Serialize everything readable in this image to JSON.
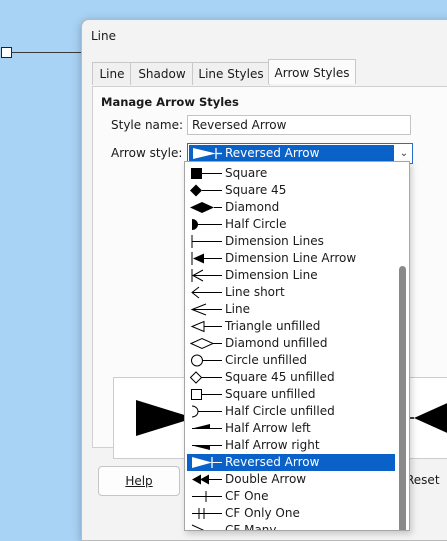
{
  "dialog": {
    "title": "Line",
    "tabs": [
      {
        "label": "Line",
        "active": false
      },
      {
        "label": "Shadow",
        "active": false
      },
      {
        "label": "Line Styles",
        "active": false
      },
      {
        "label": "Arrow Styles",
        "active": true
      }
    ],
    "section_title": "Manage Arrow Styles",
    "style_name_label": "Style name:",
    "style_name_value": "Reversed Arrow",
    "arrow_style_label": "Arrow style:",
    "arrow_style_value": "Reversed Arrow",
    "help_label": "Help",
    "reset_label": "Reset"
  },
  "dropdown": {
    "items": [
      {
        "label": "Square",
        "icon": "square-arrow-icon"
      },
      {
        "label": "Square 45",
        "icon": "square-45-arrow-icon"
      },
      {
        "label": "Diamond",
        "icon": "diamond-arrow-icon"
      },
      {
        "label": "Half Circle",
        "icon": "half-circle-arrow-icon"
      },
      {
        "label": "Dimension Lines",
        "icon": "dimension-lines-arrow-icon"
      },
      {
        "label": "Dimension Line Arrow",
        "icon": "dimension-line-arrow-icon"
      },
      {
        "label": "Dimension Line",
        "icon": "dimension-line-icon"
      },
      {
        "label": "Line short",
        "icon": "line-short-arrow-icon"
      },
      {
        "label": "Line",
        "icon": "line-arrow-icon"
      },
      {
        "label": "Triangle unfilled",
        "icon": "triangle-unfilled-arrow-icon"
      },
      {
        "label": "Diamond unfilled",
        "icon": "diamond-unfilled-arrow-icon"
      },
      {
        "label": "Circle unfilled",
        "icon": "circle-unfilled-arrow-icon"
      },
      {
        "label": "Square 45 unfilled",
        "icon": "square-45-unfilled-arrow-icon"
      },
      {
        "label": "Square unfilled",
        "icon": "square-unfilled-arrow-icon"
      },
      {
        "label": "Half Circle unfilled",
        "icon": "half-circle-unfilled-arrow-icon"
      },
      {
        "label": "Half Arrow left",
        "icon": "half-arrow-left-icon"
      },
      {
        "label": "Half Arrow right",
        "icon": "half-arrow-right-icon"
      },
      {
        "label": "Reversed Arrow",
        "icon": "reversed-arrow-icon",
        "selected": true
      },
      {
        "label": "Double Arrow",
        "icon": "double-arrow-icon"
      },
      {
        "label": "CF One",
        "icon": "cf-one-arrow-icon"
      },
      {
        "label": "CF Only One",
        "icon": "cf-only-one-arrow-icon"
      },
      {
        "label": "CF Many",
        "icon": "cf-many-arrow-icon"
      }
    ]
  },
  "colors": {
    "selection": "#0a62c9",
    "desktop": "#a9d3f5"
  }
}
